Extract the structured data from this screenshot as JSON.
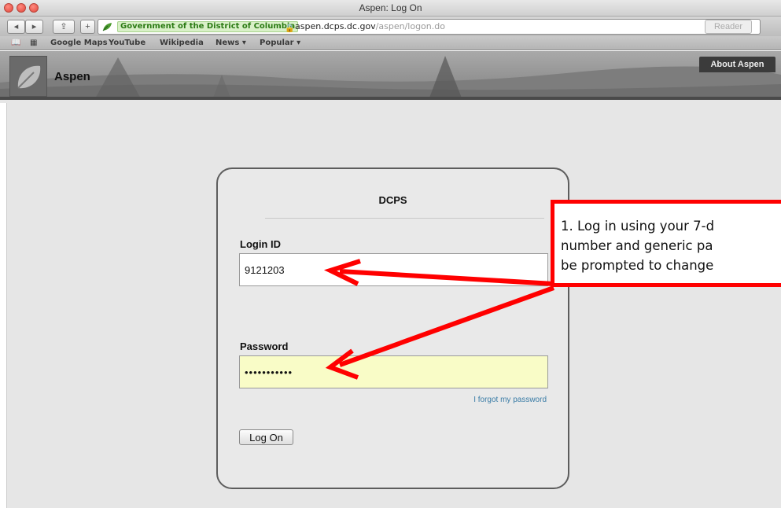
{
  "window": {
    "title": "Aspen: Log On"
  },
  "toolbar": {
    "back_icon": "back-arrow-icon",
    "forward_icon": "forward-arrow-icon",
    "share_icon": "share-icon",
    "add_icon": "plus-icon",
    "ev_badge": "Government of the District of Columbia",
    "url_host": "aspen.dcps.dc.gov",
    "url_path": "/aspen/logon.do",
    "reload_icon": "C",
    "reader_label": "Reader"
  },
  "bookmarks": [
    "Google Maps",
    "YouTube",
    "Wikipedia",
    "News ▾",
    "Popular ▾"
  ],
  "banner": {
    "app_name": "Aspen",
    "about_label": "About Aspen"
  },
  "login": {
    "org": "DCPS",
    "login_label": "Login ID",
    "login_value": "9121203",
    "password_label": "Password",
    "password_value": "•••••••••••",
    "forgot_label": "I forgot my password",
    "logon_label": "Log On"
  },
  "annotation": {
    "text": "1. Log in using your 7-d\nnumber and generic pa\nbe prompted to change",
    "color": "#ff0000"
  }
}
